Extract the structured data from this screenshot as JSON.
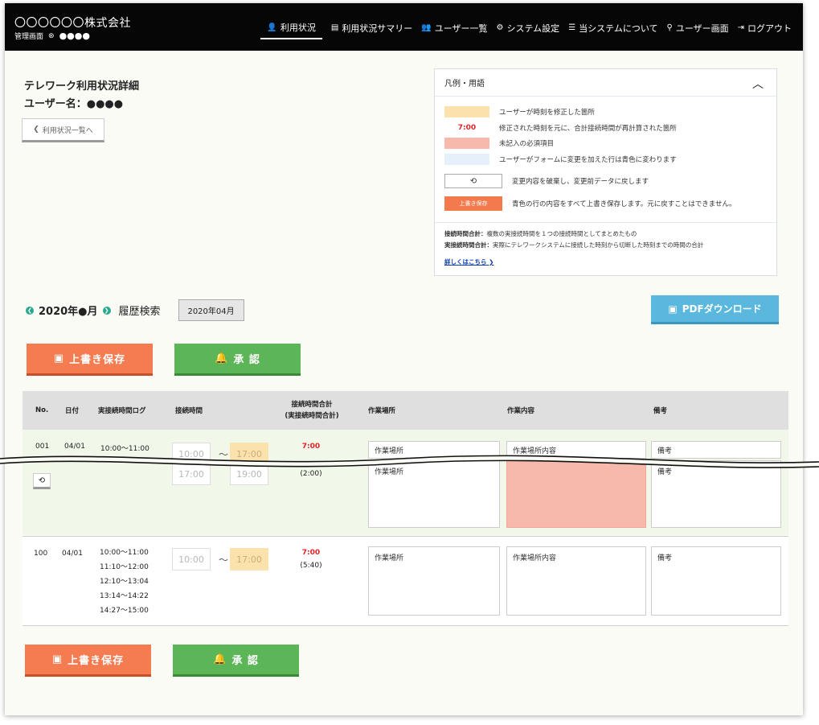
{
  "header": {
    "company": "〇〇〇〇〇〇株式会社",
    "screen": "管理画面",
    "user_icon": "user-circle-icon",
    "user": "●●●●",
    "nav": [
      {
        "label": "利用状況",
        "icon": "user-chart-icon"
      },
      {
        "label": "利用状況サマリー",
        "icon": "calendar-icon"
      },
      {
        "label": "ユーザー一覧",
        "icon": "users-icon"
      },
      {
        "label": "システム設定",
        "icon": "gear-icon"
      },
      {
        "label": "当システムについて",
        "icon": "list-icon"
      },
      {
        "label": "ユーザー画面",
        "icon": "user-icon"
      },
      {
        "label": "ログアウト",
        "icon": "logout-icon"
      }
    ]
  },
  "page": {
    "title": "テレワーク利用状況詳細",
    "user_line": "ユーザー名：●●●●",
    "back": "利用状況一覧へ"
  },
  "legend": {
    "title": "凡例・用語",
    "items": [
      {
        "swatch": "",
        "text": "ユーザーが時刻を修正した箇所"
      },
      {
        "swatch": "7:00",
        "text": "修正された時刻を元に、合計接続時間が再計算された箇所"
      },
      {
        "swatch": "",
        "text": "未記入の必須項目"
      },
      {
        "swatch": "",
        "text": "ユーザーがフォームに変更を加えた行は青色に変わります"
      },
      {
        "swatch": "⟲",
        "text": "変更内容を破棄し、変更前データに戻します"
      },
      {
        "swatch": "上書き保存",
        "text": "青色の行の内容をすべて上書き保存します。元に戻すことはできません。"
      }
    ],
    "notes": [
      {
        "term": "接続時間合計：",
        "text": "複数の実接続時間を１つの接続時間としてまとめたもの"
      },
      {
        "term": "実接続時間合計：",
        "text": "実際にテレワークシステムに接続した時刻から切断した時刻までの時間の合計"
      }
    ],
    "link": "詳しくはこちら ❯"
  },
  "month_bar": {
    "month": "2020年●月",
    "history": "履歴検索",
    "select": "2020年04月"
  },
  "buttons": {
    "pdf": "PDFダウンロード",
    "save": "上書き保存",
    "approve": "承 認"
  },
  "table": {
    "headers": [
      "No.",
      "日付",
      "実接続時間ログ",
      "接続時間",
      "接続時間合計\n(実接続時間合計)",
      "作業場所",
      "作業内容",
      "備考"
    ],
    "rows": [
      {
        "no": "001",
        "date": "04/01",
        "log": "10:00〜11:00",
        "start": "10:00",
        "end": "17:00",
        "total": "7:00",
        "real": "(2:00)",
        "start2": "17:00",
        "end2": "19:00",
        "place_top": "作業場所",
        "content_top": "作業場所内容",
        "note_top": "備考",
        "place": "作業場所",
        "content": "",
        "note": "備考"
      },
      {
        "no": "100",
        "date": "04/01",
        "logs": [
          "10:00〜11:00",
          "11:10〜12:00",
          "12:10〜13:04",
          "13:14〜14:22",
          "14:27〜15:00"
        ],
        "start": "10:00",
        "end": "17:00",
        "total": "7:00",
        "real": "(5:40)",
        "place": "作業場所",
        "content": "作業場所内容",
        "note": "備考"
      }
    ]
  }
}
